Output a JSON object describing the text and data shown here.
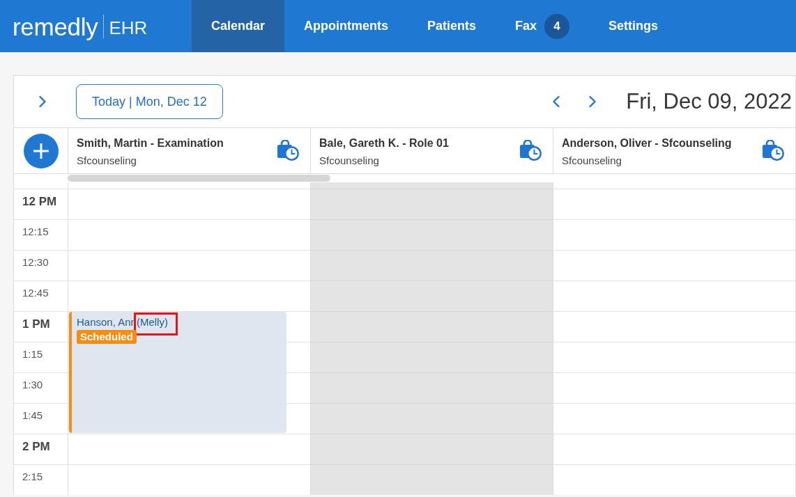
{
  "app": {
    "logo": "remedly",
    "product": "EHR"
  },
  "nav": [
    {
      "label": "Calendar",
      "selected": true
    },
    {
      "label": "Appointments",
      "selected": false
    },
    {
      "label": "Patients",
      "selected": false
    },
    {
      "label": "Fax",
      "selected": false,
      "badge": "4"
    },
    {
      "label": "Settings",
      "selected": false
    }
  ],
  "toolbar": {
    "today_button": "Today | Mon, Dec 12",
    "date": "Fri, Dec 09, 2022"
  },
  "providers": [
    {
      "name": "Smith, Martin - Examination",
      "location": "Sfcounseling"
    },
    {
      "name": "Bale, Gareth K. - Role 01",
      "location": "Sfcounseling"
    },
    {
      "name": "Anderson, Oliver - Sfcounseling",
      "location": "Sfcounseling"
    }
  ],
  "time_slots": [
    {
      "label": "12 PM",
      "kind": "hour",
      "cells": [
        {
          "available": true
        },
        {
          "available": false
        },
        {
          "available": true
        }
      ]
    },
    {
      "label": "12:15",
      "kind": "quarter",
      "cells": [
        {
          "available": true
        },
        {
          "available": false
        },
        {
          "available": true
        }
      ]
    },
    {
      "label": "12:30",
      "kind": "quarter",
      "cells": [
        {
          "available": true
        },
        {
          "available": false
        },
        {
          "available": true
        }
      ]
    },
    {
      "label": "12:45",
      "kind": "quarter",
      "cells": [
        {
          "available": true
        },
        {
          "available": false
        },
        {
          "available": true
        }
      ]
    },
    {
      "label": "1 PM",
      "kind": "hour",
      "cells": [
        {
          "available": true,
          "appointment": {
            "patient": "Hanson, Ann",
            "nickname": "(Melly)",
            "nickname_marked": true,
            "status": "Scheduled",
            "color": "#f68d0f"
          }
        },
        {
          "available": false
        },
        {
          "available": true
        }
      ]
    },
    {
      "label": "1:15",
      "kind": "quarter",
      "cells": [
        {
          "available": true,
          "booked": true
        },
        {
          "available": false
        },
        {
          "available": true
        }
      ]
    },
    {
      "label": "1:30",
      "kind": "quarter",
      "cells": [
        {
          "available": true,
          "booked": true
        },
        {
          "available": false
        },
        {
          "available": true
        }
      ]
    },
    {
      "label": "1:45",
      "kind": "quarter",
      "cells": [
        {
          "available": true,
          "booked": true
        },
        {
          "available": false
        },
        {
          "available": true
        }
      ]
    },
    {
      "label": "2 PM",
      "kind": "hour",
      "cells": [
        {
          "available": true
        },
        {
          "available": false
        },
        {
          "available": true
        }
      ]
    },
    {
      "label": "2:15",
      "kind": "quarter",
      "cells": [
        {
          "available": true
        },
        {
          "available": false
        },
        {
          "available": true
        }
      ]
    }
  ]
}
